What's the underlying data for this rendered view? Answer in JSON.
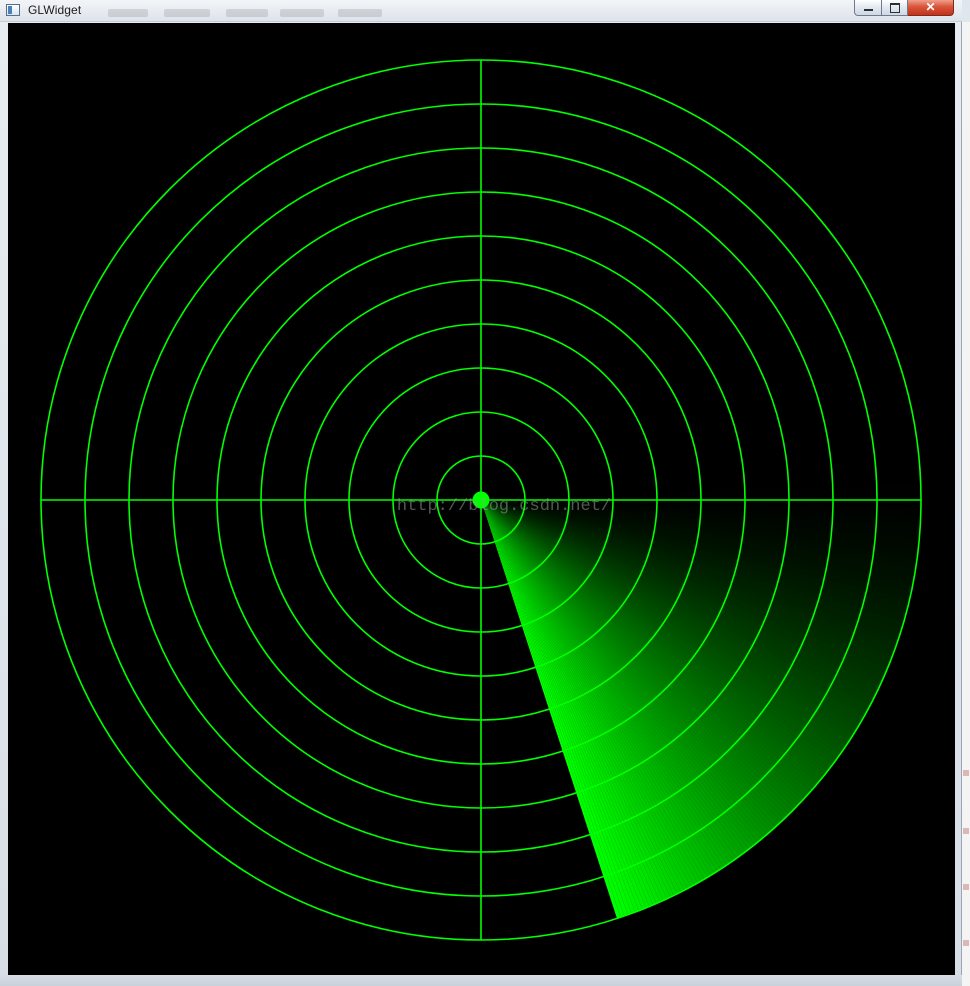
{
  "window": {
    "title": "GLWidget",
    "icon": "app-window-icon",
    "controls": {
      "minimize_icon": "minimize-icon",
      "maximize_icon": "maximize-icon",
      "close_label": "✕"
    }
  },
  "radar": {
    "watermark": "http://blog.csdn.net/",
    "ring_count": 10,
    "line_color": "#00ff00",
    "background_color": "#000000",
    "sweep_color": "#00ff00",
    "sweep": {
      "leading_edge_deg": 162,
      "trail_deg": 75
    }
  }
}
